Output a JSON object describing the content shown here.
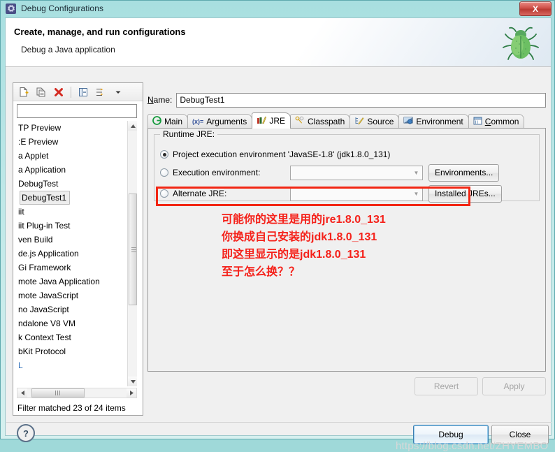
{
  "window": {
    "title": "Debug Configurations",
    "icon": "gear-icon",
    "close_label": "X",
    "accent_teal": "#a8dfe0",
    "close_red": "#cf5048"
  },
  "header": {
    "title": "Create, manage, and run configurations",
    "subtitle": "Debug a Java application",
    "decor_icon": "green-bug-icon"
  },
  "left_pane": {
    "toolbar": [
      {
        "name": "new-configuration-icon",
        "label": "New launch configuration"
      },
      {
        "name": "duplicate-configuration-icon",
        "label": "Duplicate"
      },
      {
        "name": "delete-configuration-icon",
        "label": "Delete"
      },
      {
        "name": "collapse-all-icon",
        "label": "Collapse All"
      },
      {
        "name": "filter-configurations-icon",
        "label": "Filter"
      },
      {
        "name": "view-menu-chevron-icon",
        "label": "View Menu"
      }
    ],
    "filter_value": "",
    "filter_placeholder": "",
    "items": [
      {
        "label": "TP Preview",
        "selected": false,
        "blue": false
      },
      {
        "label": ":E Preview",
        "selected": false,
        "blue": false
      },
      {
        "label": "a Applet",
        "selected": false,
        "blue": false
      },
      {
        "label": "a Application",
        "selected": false,
        "blue": false
      },
      {
        "label": "DebugTest",
        "selected": false,
        "blue": false
      },
      {
        "label": "DebugTest1",
        "selected": true,
        "blue": false
      },
      {
        "label": "iit",
        "selected": false,
        "blue": false
      },
      {
        "label": "iit Plug-in Test",
        "selected": false,
        "blue": false
      },
      {
        "label": "ven Build",
        "selected": false,
        "blue": false
      },
      {
        "label": "de.js Application",
        "selected": false,
        "blue": false
      },
      {
        "label": "Gi Framework",
        "selected": false,
        "blue": false
      },
      {
        "label": "mote Java Application",
        "selected": false,
        "blue": false
      },
      {
        "label": "mote JavaScript",
        "selected": false,
        "blue": false
      },
      {
        "label": "no JavaScript",
        "selected": false,
        "blue": false
      },
      {
        "label": "ndalone V8 VM",
        "selected": false,
        "blue": false
      },
      {
        "label": "k Context Test",
        "selected": false,
        "blue": false
      },
      {
        "label": "bKit Protocol",
        "selected": false,
        "blue": false
      },
      {
        "label": "L",
        "selected": false,
        "blue": true
      }
    ],
    "status": "Filter matched 23 of 24 items"
  },
  "right_pane": {
    "name_label": "Name:",
    "name_value": "DebugTest1",
    "tabs": [
      {
        "label": "Main",
        "icon": "main-green-circle-icon",
        "active": false
      },
      {
        "label": "Arguments",
        "icon": "arguments-variable-icon",
        "active": false
      },
      {
        "label": "JRE",
        "icon": "jre-books-icon",
        "active": true
      },
      {
        "label": "Classpath",
        "icon": "classpath-keys-icon",
        "active": false
      },
      {
        "label": "Source",
        "icon": "source-pencil-icon",
        "active": false
      },
      {
        "label": "Environment",
        "icon": "environment-monitor-icon",
        "active": false
      },
      {
        "label": "Common",
        "icon": "common-window-icon",
        "active": false
      }
    ],
    "jre_group": {
      "title": "Runtime JRE:",
      "options": [
        {
          "label": "Project execution environment 'JavaSE-1.8' (jdk1.8.0_131)",
          "checked": true,
          "has_combo": false,
          "button": null,
          "highlighted": false
        },
        {
          "label": "Execution environment:",
          "checked": false,
          "has_combo": true,
          "combo_value": "",
          "button": "Environments...",
          "highlighted": false
        },
        {
          "label": "Alternate JRE:",
          "checked": false,
          "has_combo": true,
          "combo_value": "",
          "button": "Installed JREs...",
          "highlighted": true
        }
      ],
      "highlight_color": "#f22613"
    },
    "annotation": {
      "color": "#f5211a",
      "lines": [
        "可能你的这里是用的jre1.8.0_131",
        "你换成自己安装的jdk1.8.0_131",
        "即这里显示的是jdk1.8.0_131",
        "至于怎么换？？"
      ]
    },
    "revert_label": "Revert",
    "apply_label": "Apply"
  },
  "footer": {
    "help_icon": "help-question-icon",
    "debug_label": "Debug",
    "close_label": "Close",
    "watermark": "https://blog.csdn.net/ZHYEMBO"
  }
}
